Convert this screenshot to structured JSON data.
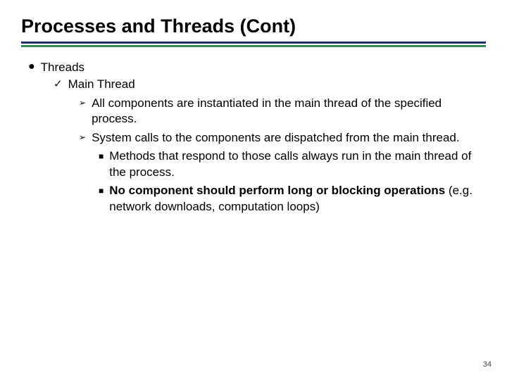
{
  "title": "Processes and Threads (Cont)",
  "colors": {
    "ruleNavy": "#1c2b6b",
    "ruleGreen": "#2e8b4f"
  },
  "bullets": {
    "lvl1": "Threads",
    "lvl2": "Main Thread",
    "lvl3a": "All components are instantiated in the main thread of the specified process.",
    "lvl3b": "System calls to the components are dispatched from the main thread.",
    "lvl4a": "Methods that respond to those calls always run in the main thread of the process.",
    "lvl4b_bold": "No component should perform long or blocking operations",
    "lvl4b_rest": " (e.g. network downloads, computation loops)"
  },
  "icons": {
    "dot": "●",
    "check": "✓",
    "triangle": "➢",
    "square": "■"
  },
  "pageNumber": "34"
}
